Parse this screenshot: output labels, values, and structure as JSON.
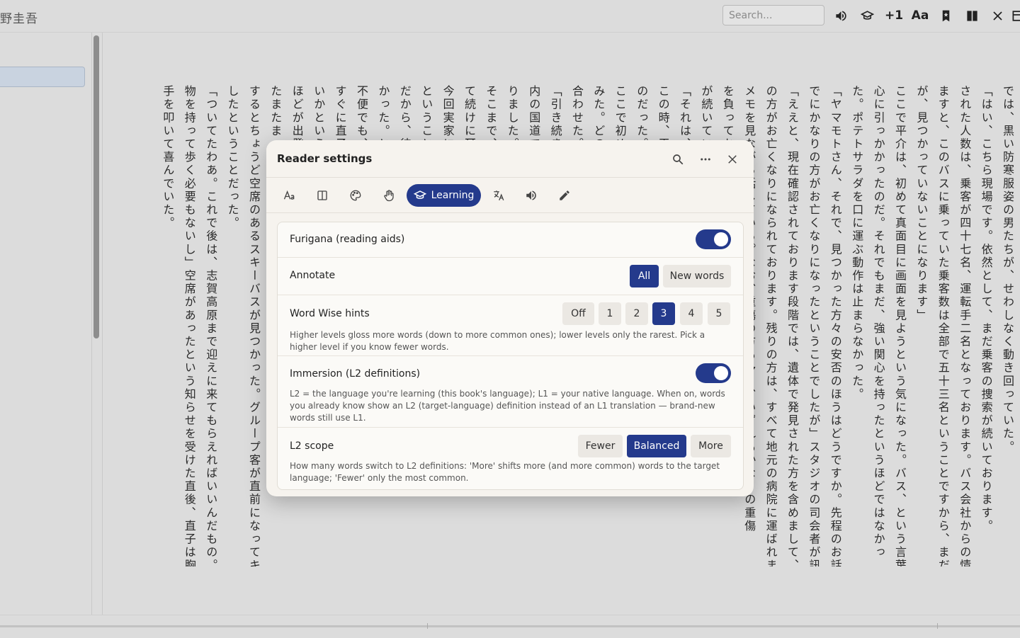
{
  "topbar": {
    "book_title": "野圭吾",
    "search_placeholder": "Search...",
    "plus_one": "+1",
    "font_label": "Aa",
    "icons": [
      "volume-icon",
      "graduation-cap-icon",
      "plus-one-button",
      "font-size-icon",
      "bookmark-icon",
      "columns-icon",
      "close-icon",
      "sidebar-icon"
    ]
  },
  "text_columns": [
    "では、黒い防寒服姿の男たちが、せわしなく動き回っていた。",
    "「はい、こちら現場です。依然として、まだ乗客の捜索が続いております。",
    "された人数は、乗客が四十七名、運転手二名となっております。バス会社からの情報により",
    "ますと、このバスに乗っていた乗客数は全部で五十三名ということですから、まだ六人の方",
    "が、見つかっていないことになります」",
    "ここで平介は、初めて真面目に画面を見ようという気になった。バス、という言葉が彼の",
    "心に引っかかったのだ。それでもまだ、強い関心を持ったというほどではなかっ",
    "た。ポテトサラダを口に運ぶ動作は止まらなかった。",
    "「ヤマモトさん、それで、見つかった方々の安否のほうはどうですか。先程のお話では、す",
    "でにかなりの方がお亡くなりになったということでしたが」スタジオの司会者が訊いた。",
    "「ええと、現在確認されております段階では、遺体で発見された方を含めまして、二十六人",
    "の方がお亡くなりになられております。残りの方は、すべて地元の病院に運ばれました」",
    "メモを見ながら話している。なお、重傷の方も多く、いずれもかなりの重傷",
    "を負っておられるということで、懸命の治療",
    "が続いているということです。",
    "「それは、大変な事故ですね」",
    "この時、平介はまだ、それが他人事だと思っていた。",
    "のだった。ここで初めて、という",
    "ここで初めて、それが",
    "みた。どのような状況であったのか、NHKに",
    "合わせた。トンネルを変えて",
    "「引き続き、長野県長野市",
    "内の国道で事故が起こ",
    "りました。",
    "そこまで、アナウンサーが、立",
    "て続けに耳に入る。通。",
    "今回実家に帰る手段を使うか",
    "ということで、平介も一緒",
    "だから、彼らは運転ができな",
    "かった。ところが",
    "不便でも、",
    "すぐに直子は便乗できな",
    "いかという話に一日で二百本",
    "ほどが出発し、便を頼んだ。",
    "たまたま",
    "するとちょうど空席のあるスキーバスが見つかった。グループ客が直前になってキャンセル",
    "したということだった。",
    "「ついてたわあ。これで後は、志賀高原まで迎えに来てもらえればいいんだもの。重い荷",
    "物を持って歩く必要もないし」空席があったという知らせを受けた直後、直子は胸の前で",
    "手を叩いて喜んでいた。"
  ],
  "dialog": {
    "title": "Reader settings",
    "tabs": [
      "typography",
      "layout",
      "theme",
      "gestures",
      "Learning",
      "translate",
      "audio",
      "edit"
    ],
    "active_tab_label": "Learning",
    "rows": {
      "furigana": {
        "label": "Furigana (reading aids)",
        "on": true
      },
      "annotate": {
        "label": "Annotate",
        "options": [
          "All",
          "New words"
        ],
        "selected": "All"
      },
      "word_wise": {
        "label": "Word Wise hints",
        "options": [
          "Off",
          "1",
          "2",
          "3",
          "4",
          "5"
        ],
        "selected": "3",
        "help": "Higher levels gloss more words (down to more common ones); lower levels only the rarest. Pick a higher level if you know fewer words."
      },
      "immersion": {
        "label": "Immersion (L2 definitions)",
        "on": true,
        "help": "L2 = the language you're learning (this book's language); L1 = your native language. When on, words you already know show an L2 (target-language) definition instead of an L1 translation — brand-new words still use L1."
      },
      "l2_scope": {
        "label": "L2 scope",
        "options": [
          "Fewer",
          "Balanced",
          "More"
        ],
        "selected": "Balanced",
        "help": "How many words switch to L2 definitions: 'More' shifts more (and more common) words to the target language; 'Fewer' only the most common."
      }
    }
  },
  "colors": {
    "accent": "#243a8c",
    "dialog_bg": "#f6f3ee",
    "app_bg": "#dcdcdc"
  }
}
